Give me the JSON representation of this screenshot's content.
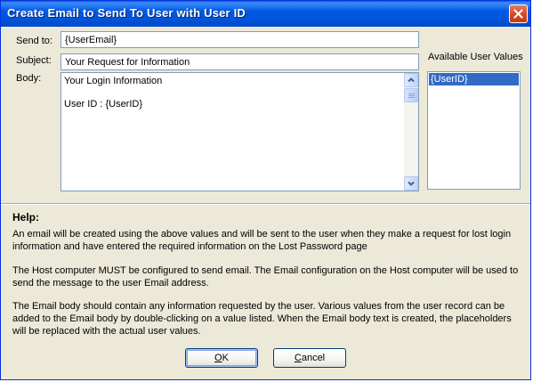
{
  "window": {
    "title": "Create Email to Send To User with User ID"
  },
  "form": {
    "send_to_label": "Send to:",
    "send_to_value": "{UserEmail}",
    "subject_label": "Subject:",
    "subject_value": "Your Request for Information",
    "body_label": "Body:",
    "body_lines": [
      "Your Login Information",
      "",
      "User ID : {UserID}"
    ]
  },
  "available_values": {
    "label": "Available User Values",
    "items": [
      "{UserID}"
    ]
  },
  "help": {
    "title": "Help:",
    "paragraphs": [
      "An email will be created using the above values and will be sent to the user when they make a request for lost login information and have entered the required information on the Lost Password page",
      "The Host computer MUST be configured to send email. The Email configuration on the Host computer will be used to send the message to the user Email address.",
      "The Email body should contain any information requested by the user.  Various values from the user record can be added to the Email body by double-clicking on a value listed. When the Email body text is created, the placeholders will be replaced with the actual user values."
    ]
  },
  "buttons": {
    "ok_accel": "O",
    "ok_rest": "K",
    "cancel_accel": "C",
    "cancel_rest": "ancel"
  }
}
